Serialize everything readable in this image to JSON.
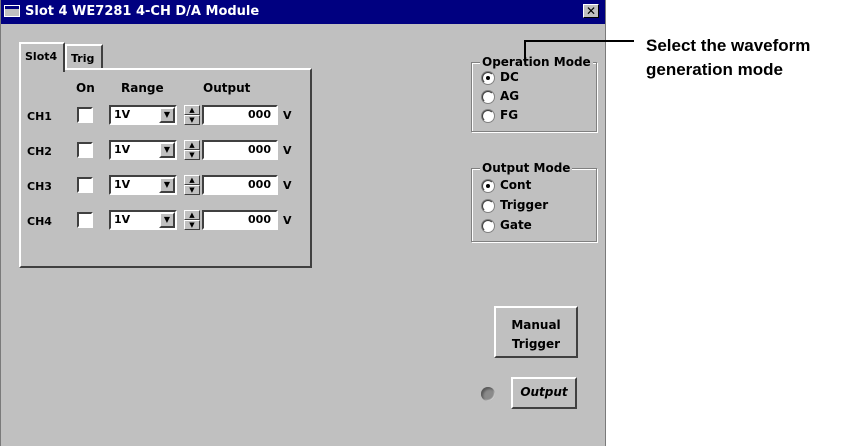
{
  "window": {
    "title": "Slot 4 WE7281 4-CH D/A Module",
    "close_label": "✕"
  },
  "tabs": [
    {
      "label": "Slot4",
      "active": true
    },
    {
      "label": "Trig",
      "active": false
    }
  ],
  "columns": {
    "on": "On",
    "range": "Range",
    "output": "Output"
  },
  "channels": [
    {
      "label": "CH1",
      "on": false,
      "range": "1V",
      "output": "000",
      "unit": "V"
    },
    {
      "label": "CH2",
      "on": false,
      "range": "1V",
      "output": "000",
      "unit": "V"
    },
    {
      "label": "CH3",
      "on": false,
      "range": "1V",
      "output": "000",
      "unit": "V"
    },
    {
      "label": "CH4",
      "on": false,
      "range": "1V",
      "output": "000",
      "unit": "V"
    }
  ],
  "operation_mode": {
    "title": "Operation Mode",
    "options": [
      "DC",
      "AG",
      "FG"
    ],
    "selected": "DC"
  },
  "output_mode": {
    "title": "Output Mode",
    "options": [
      "Cont",
      "Trigger",
      "Gate"
    ],
    "selected": "Cont"
  },
  "manual_trigger": {
    "line1": "Manual",
    "line2": "Trigger"
  },
  "output_button": {
    "label": "Output"
  },
  "callout": {
    "line1": "Select the waveform",
    "line2": "generation mode"
  },
  "icons": {
    "spin": "spin-updown-icon",
    "dropdown": "chevron-down-icon",
    "led": "status-led-icon"
  }
}
